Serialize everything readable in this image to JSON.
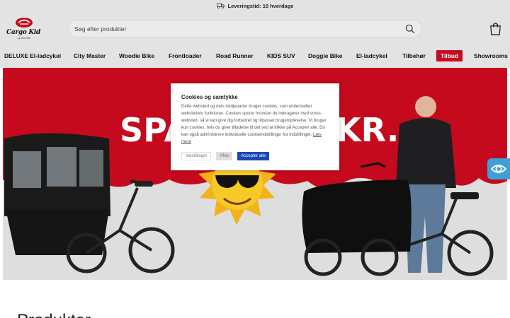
{
  "topbar": {
    "delivery_text": "Leveringstid: 10 hverdage",
    "icon": "truck-icon"
  },
  "header": {
    "logo_text": "Cargo Kid",
    "logo_tagline": "...ny cool ride",
    "search_placeholder": "Søg efter produkter",
    "search_icon": "search-icon",
    "cart_icon": "shopping-bag-icon"
  },
  "nav": {
    "items": [
      {
        "label": "DELUXE El-ladcykel"
      },
      {
        "label": "City Master"
      },
      {
        "label": "Woodie Bike"
      },
      {
        "label": "Frontloader"
      },
      {
        "label": "Road Runner"
      },
      {
        "label": "KIDS SUV"
      },
      {
        "label": "Doggie Bike"
      },
      {
        "label": "El-ladcykel"
      },
      {
        "label": "Tilbehør"
      },
      {
        "label": "Tilbud",
        "active": true
      },
      {
        "label": "Showrooms"
      }
    ]
  },
  "hero": {
    "banner_text": "SPAR ... KR.",
    "banner_left": "SPA",
    "banner_right": "KR.",
    "brand_color": "#c40a1c"
  },
  "cookie": {
    "title": "Cookies og samtykke",
    "body": "Dette websted og dets tredjeparter bruger cookies, som understøtter webstedets funktioner. Cookies sporer hvordan du interagerer med vores websted, så vi kan give dig forbedret og tilpasset brugeroplevelse. Vi bruger kun cookies, hvis du giver tilladelse til det ved at klikke på Accepter alle. Du kan også administrere individuelle cookieindstillinger fra Indstillinger.",
    "link": "Læs mere",
    "settings_label": "Indstillinger",
    "reject_label": "Afvis",
    "accept_label": "Accepter alle",
    "accept_color": "#1a48b4"
  },
  "page": {
    "heading": "Produkter"
  },
  "accessibility": {
    "icon": "accessibility-eye-icon",
    "color": "#3fa0d8"
  }
}
